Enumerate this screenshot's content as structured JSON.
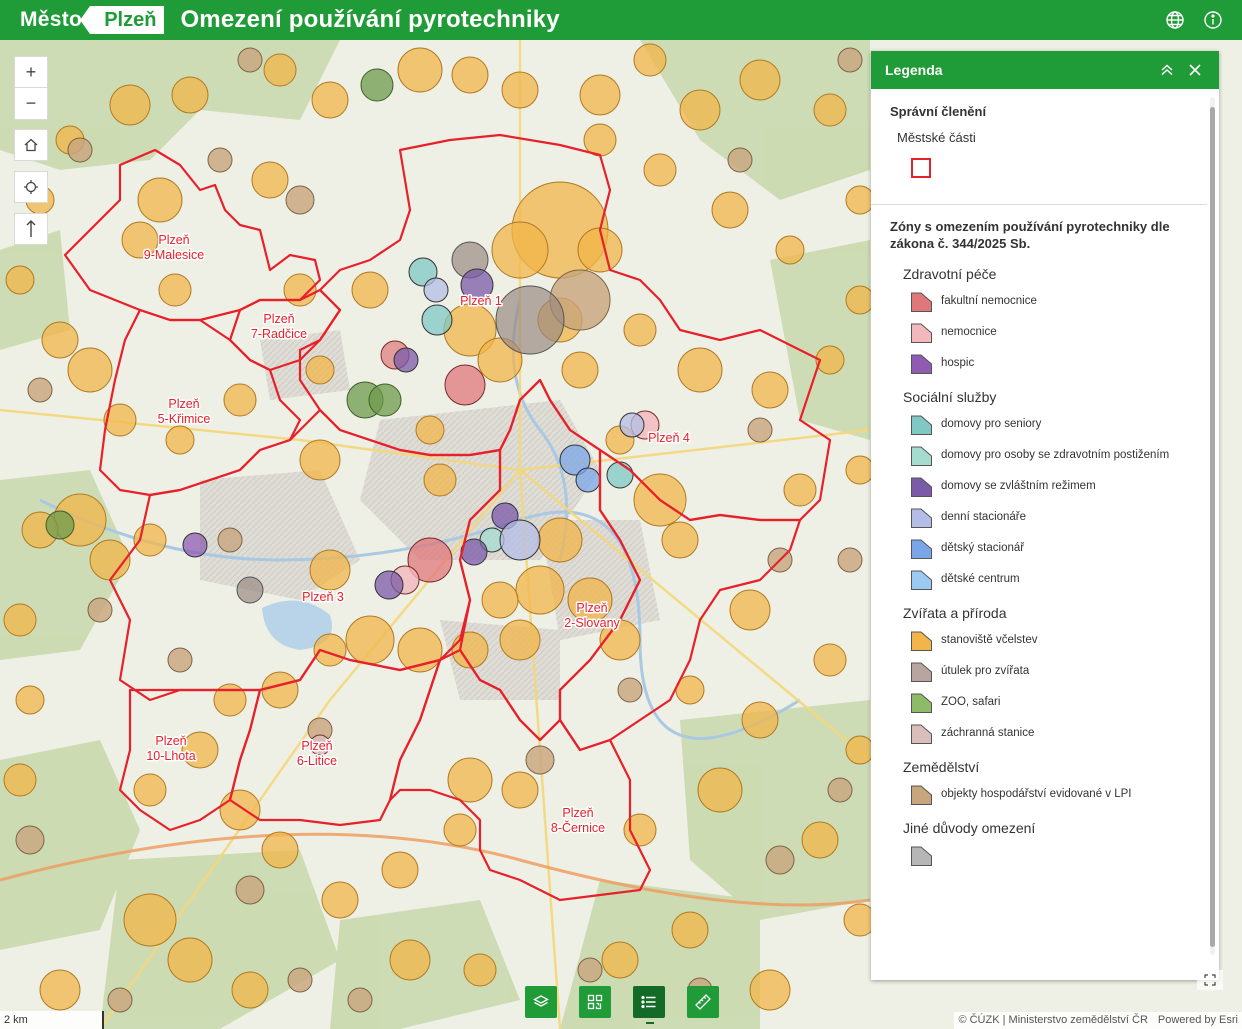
{
  "header": {
    "logo_mesto": "Město",
    "logo_plzen": "Plzeň",
    "title": "Omezení používání pyrotechniky",
    "icons": [
      "globe-icon",
      "info-icon"
    ]
  },
  "map": {
    "zone_labels": {
      "plzen1": [
        "Plzeň 1"
      ],
      "plzen2": [
        "Plzeň",
        "2-Slovany"
      ],
      "plzen3": [
        "Plzeň 3"
      ],
      "plzen4": [
        "Plzeň 4"
      ],
      "plzen5": [
        "Plzeň",
        "5-Křimice"
      ],
      "plzen6": [
        "Plzeň",
        "6-Litice"
      ],
      "plzen7": [
        "Plzeň",
        "7-Radčice"
      ],
      "plzen8": [
        "Plzeň",
        "8-Černice"
      ],
      "plzen9": [
        "Plzeň",
        "9-Malesice"
      ],
      "plzen10": [
        "Plzeň",
        "10-Lhota"
      ]
    },
    "boundary_color": "#e8202a",
    "zoom_in": "+",
    "zoom_out": "−",
    "scale_label": "2 km",
    "attribution": {
      "source": "© ČÚZK | Ministerstvo zemědělství ČR",
      "powered": "Powered by Esri"
    }
  },
  "legend": {
    "title": "Legenda",
    "section1_title": "Správní členění",
    "section1_sub": "Městské části",
    "section2_title": "Zóny s omezením používání pyrotechniky dle zákona č. 344/2025 Sb.",
    "groups": [
      {
        "name": "Zdravotní péče",
        "items": [
          {
            "label": "fakultní nemocnice",
            "color": "#e0777a"
          },
          {
            "label": "nemocnice",
            "color": "#f2b8bb"
          },
          {
            "label": "hospic",
            "color": "#8f5bb3"
          }
        ]
      },
      {
        "name": "Sociální služby",
        "items": [
          {
            "label": "domovy pro seniory",
            "color": "#7fc8c4"
          },
          {
            "label": "domovy pro osoby se zdravotním postižením",
            "color": "#a6dccf"
          },
          {
            "label": "domovy se zvláštním režimem",
            "color": "#7b5aa8"
          },
          {
            "label": "denní stacionáře",
            "color": "#b4bde6"
          },
          {
            "label": "dětský stacionář",
            "color": "#7aa6e8"
          },
          {
            "label": "dětské centrum",
            "color": "#9ccaf2"
          }
        ]
      },
      {
        "name": "Zvířata a příroda",
        "items": [
          {
            "label": "stanoviště včelstev",
            "color": "#f2b54a"
          },
          {
            "label": "útulek pro zvířata",
            "color": "#b9a59f"
          },
          {
            "label": "ZOO, safari",
            "color": "#8ebb68"
          },
          {
            "label": "záchranná stanice",
            "color": "#d9bebb"
          }
        ]
      },
      {
        "name": "Zemědělství",
        "items": [
          {
            "label": "objekty hospodářství evidované v LPI",
            "color": "#c8a57d"
          }
        ]
      },
      {
        "name": "Jiné důvody omezení",
        "items": [
          {
            "label": "",
            "color": "#b6b6b6"
          }
        ]
      }
    ]
  },
  "toolbar": {
    "buttons": [
      "layers-icon",
      "qr-code-icon",
      "legend-list-icon",
      "measure-ruler-icon"
    ],
    "active": "legend-list-icon"
  }
}
